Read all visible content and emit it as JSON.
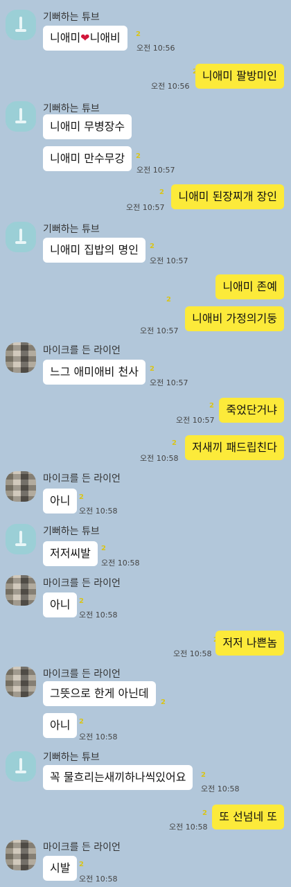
{
  "senders": {
    "tube": "기뻐하는 튜브",
    "lion": "마이크를 든 라이언"
  },
  "unread": "2",
  "messages": [
    {
      "text": "니애미",
      "heart": "❤",
      "text2": "니애비",
      "time": "오전 10:56"
    },
    {
      "text": "니애미 팔방미인",
      "time": "오전 10:56"
    },
    {
      "text": "니애미 무병장수"
    },
    {
      "text": "니애미 만수무강",
      "time": "오전 10:57"
    },
    {
      "text": "니애미 된장찌개 장인",
      "time": "오전 10:57"
    },
    {
      "text": "니애미 집밥의 명인",
      "time": "오전 10:57"
    },
    {
      "text": "니애미 존예"
    },
    {
      "text": "니애비 가정의기둥",
      "time": "오전 10:57"
    },
    {
      "text": "느그 애미애비 천사",
      "time": "오전 10:57"
    },
    {
      "text": "죽었단거냐",
      "time": "오전 10:57"
    },
    {
      "text": "저새끼 패드립친다",
      "time": "오전 10:58"
    },
    {
      "text": "아니",
      "time": "오전 10:58"
    },
    {
      "text": "저저씨발",
      "time": "오전 10:58"
    },
    {
      "text": "아니",
      "time": "오전 10:58"
    },
    {
      "text": "저저 나쁜놈",
      "time": "오전 10:58"
    },
    {
      "text": "그뜻으로 한게 아닌데"
    },
    {
      "text": "아니",
      "time": "오전 10:58"
    },
    {
      "text": "꼭 물흐리는새끼하나씩있어요",
      "time": "오전 10:58"
    },
    {
      "text": "또 선넘네 또",
      "time": "오전 10:58"
    },
    {
      "text": "시발",
      "time": "오전 10:58"
    }
  ]
}
